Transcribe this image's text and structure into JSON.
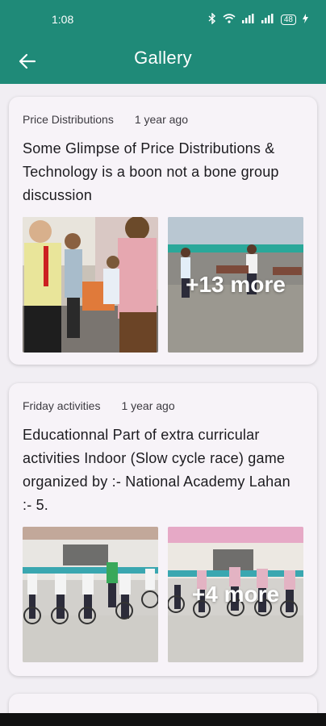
{
  "status_bar": {
    "time": "1:08",
    "battery": "48",
    "icons": [
      "bluetooth-icon",
      "wifi-icon",
      "signal-icon",
      "signal-icon",
      "battery-icon",
      "charging-icon"
    ]
  },
  "app_bar": {
    "title": "Gallery",
    "back_icon": "arrow-left-icon",
    "color": "#1f8a78"
  },
  "posts": [
    {
      "category": "Price Distributions",
      "time": "1 year ago",
      "title": "Some Glimpse of Price Distributions & Technology is a boon not a bone group discussion",
      "more_label": "+13 more"
    },
    {
      "category": "Friday activities",
      "time": "1 year ago",
      "title": "Educationnal Part of extra curricular activities Indoor  (Slow cycle race) game organized by :- National Academy Lahan :- 5.",
      "more_label": "+4 more"
    }
  ]
}
